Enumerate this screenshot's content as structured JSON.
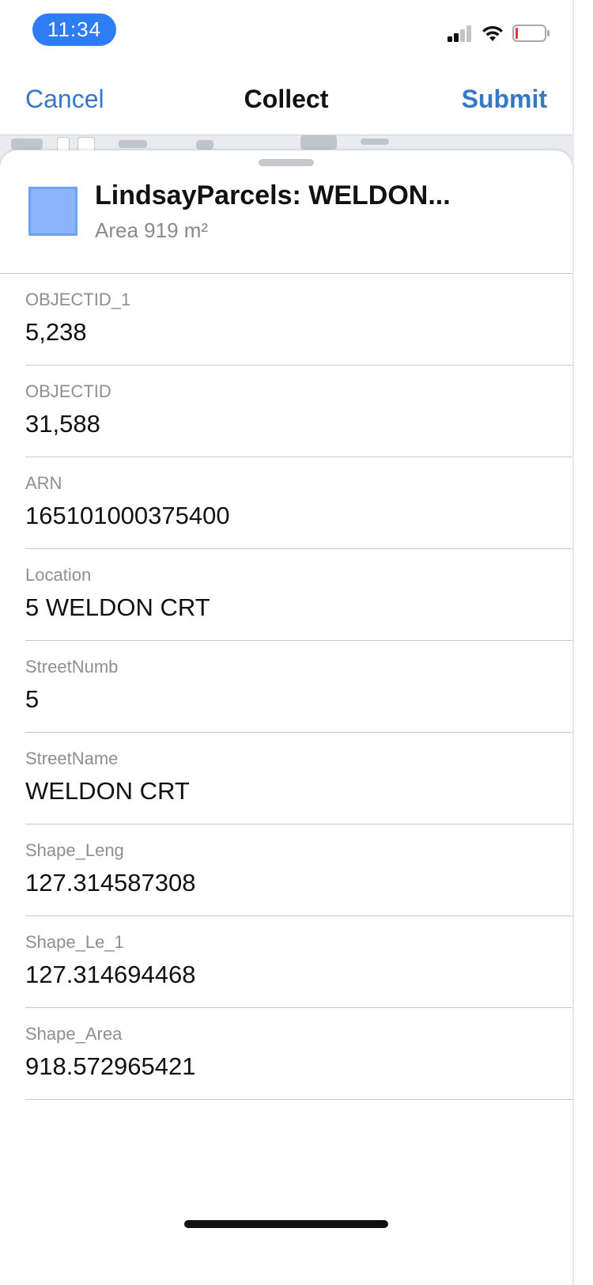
{
  "status_bar": {
    "time": "11:34",
    "icons": [
      "cellular-signal-icon",
      "wifi-icon",
      "battery-low-icon"
    ]
  },
  "nav": {
    "cancel_label": "Cancel",
    "title": "Collect",
    "submit_label": "Submit",
    "accent_color": "#3478c6"
  },
  "feature": {
    "title": "LindsayParcels: WELDON...",
    "subtitle": "Area 919 m²",
    "swatch_color": "#8ab4fb"
  },
  "fields": [
    {
      "label": "OBJECTID_1",
      "value": "5,238"
    },
    {
      "label": "OBJECTID",
      "value": "31,588"
    },
    {
      "label": "ARN",
      "value": "165101000375400"
    },
    {
      "label": "Location",
      "value": "5 WELDON CRT"
    },
    {
      "label": "StreetNumb",
      "value": "5"
    },
    {
      "label": "StreetName",
      "value": "WELDON CRT"
    },
    {
      "label": "Shape_Leng",
      "value": "127.314587308"
    },
    {
      "label": "Shape_Le_1",
      "value": "127.314694468"
    },
    {
      "label": "Shape_Area",
      "value": "918.572965421"
    }
  ]
}
